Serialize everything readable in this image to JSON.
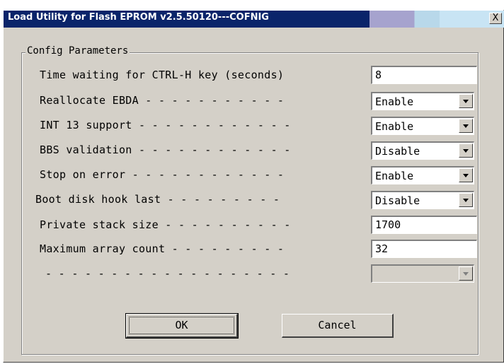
{
  "window": {
    "title": "Load Utility for Flash EPROM v2.5.50120---COFNIG",
    "close_label": "X"
  },
  "group": {
    "title": "Config Parameters"
  },
  "params": [
    {
      "label": "Time waiting for CTRL-H key (seconds)",
      "control": "text",
      "value": "8"
    },
    {
      "label": "Reallocate EBDA - - - - - - - - - - -",
      "control": "dropdown",
      "value": "Enable"
    },
    {
      "label": "INT 13 support - - - - - - - - - - - -",
      "control": "dropdown",
      "value": "Enable"
    },
    {
      "label": "BBS validation - - - - - - - - - - - -",
      "control": "dropdown",
      "value": "Disable"
    },
    {
      "label": "Stop on error - - - - - - - - - - - -",
      "control": "dropdown",
      "value": "Enable"
    },
    {
      "label": "Boot disk hook last - - - - - - - - -",
      "control": "dropdown",
      "value": "Disable"
    },
    {
      "label": "Private stack size - - - - - - - - - -",
      "control": "text",
      "value": "1700"
    },
    {
      "label": "Maximum array count - - - - - - - - -",
      "control": "text",
      "value": "32"
    },
    {
      "label": "- - - - - - - - - - - - - - - - - - -",
      "control": "dropdown-disabled",
      "value": ""
    }
  ],
  "buttons": {
    "ok": "OK",
    "cancel": "Cancel"
  }
}
